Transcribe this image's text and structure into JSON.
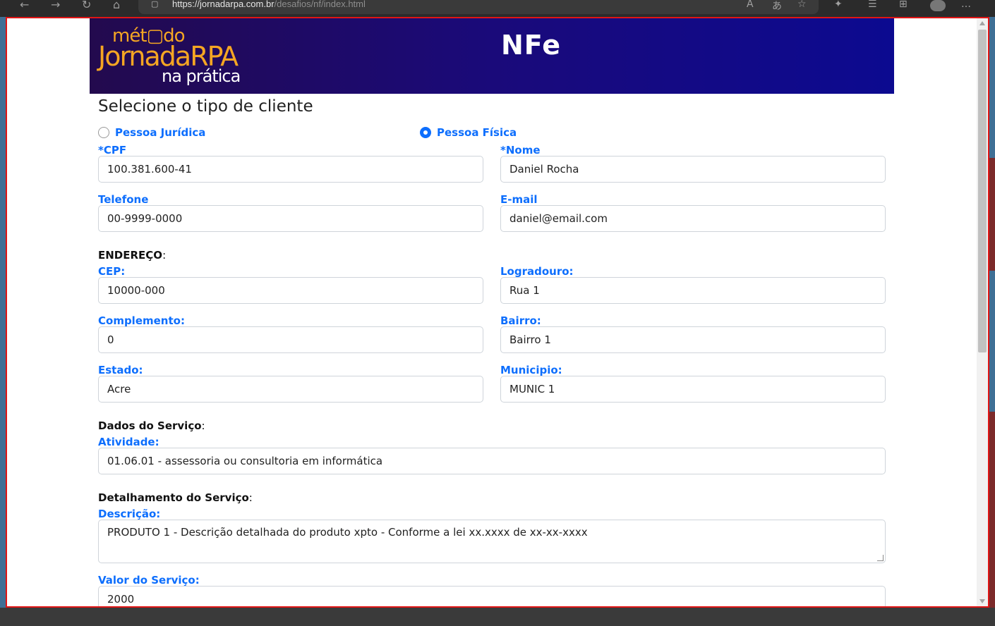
{
  "browser": {
    "url_host": "https://jornadarpa.com.br",
    "url_path": "/desafios/nf/index.html"
  },
  "banner": {
    "logo_line1": "mét▢do",
    "logo_line2": "JornadaRPA",
    "logo_line3": "na prática",
    "title": "NFe"
  },
  "form": {
    "heading": "Selecione o tipo de cliente",
    "client_types": [
      {
        "label": "Pessoa Jurídica",
        "selected": false
      },
      {
        "label": "Pessoa Física",
        "selected": true
      }
    ],
    "cpf": {
      "label": "*CPF",
      "value": "100.381.600-41"
    },
    "nome": {
      "label": "*Nome",
      "value": "Daniel Rocha"
    },
    "telefone": {
      "label": "Telefone",
      "value": "00-9999-0000"
    },
    "email": {
      "label": "E-mail",
      "value": "daniel@email.com"
    },
    "endereco_heading": "ENDEREÇO",
    "cep": {
      "label": "CEP:",
      "value": "10000-000"
    },
    "logradouro": {
      "label": "Logradouro:",
      "value": "Rua 1"
    },
    "complemento": {
      "label": "Complemento:",
      "value": "0"
    },
    "bairro": {
      "label": "Bairro:",
      "value": "Bairro 1"
    },
    "estado": {
      "label": "Estado:",
      "value": "Acre"
    },
    "municipio": {
      "label": "Municipio:",
      "value": "MUNIC 1"
    },
    "servico_heading": "Dados do Serviço",
    "atividade": {
      "label": "Atividade:",
      "value": "01.06.01 - assessoria ou consultoria em informática"
    },
    "detalhamento_heading": "Detalhamento do Serviço",
    "descricao": {
      "label": "Descrição:",
      "value": "PRODUTO 1   - Descrição detalhada do produto xpto - Conforme a lei xx.xxxx de xx-xx-xxxx"
    },
    "valor": {
      "label": "Valor do Serviço:",
      "value": "2000"
    }
  },
  "colors": {
    "accent": "#0d6efd",
    "banner_start": "#230a4e",
    "banner_end": "#0c0a90",
    "logo_orange": "#f5a623",
    "frame_red": "#e01515"
  }
}
